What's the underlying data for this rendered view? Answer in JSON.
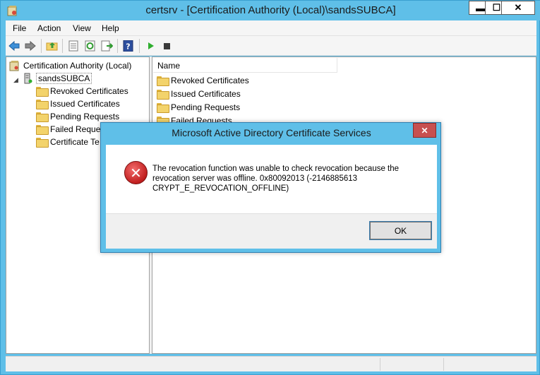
{
  "window": {
    "title": "certsrv - [Certification Authority (Local)\\sandsSUBCA]",
    "minimize_glyph": "▬",
    "maximize_glyph": "☐",
    "close_glyph": "✕"
  },
  "menu": [
    "File",
    "Action",
    "View",
    "Help"
  ],
  "toolbar_icons": [
    "back-arrow-icon",
    "forward-arrow-icon",
    "up-folder-icon",
    "properties-icon",
    "refresh-icon",
    "export-list-icon",
    "help-icon",
    "start-service-icon",
    "stop-service-icon"
  ],
  "tree": {
    "root": "Certification Authority (Local)",
    "server": "sandsSUBCA",
    "children": [
      "Revoked Certificates",
      "Issued Certificates",
      "Pending Requests",
      "Failed Reques",
      "Certificate Te"
    ]
  },
  "list": {
    "column_header": "Name",
    "items": [
      "Revoked Certificates",
      "Issued Certificates",
      "Pending Requests",
      "Failed Requests"
    ]
  },
  "dialog": {
    "title": "Microsoft Active Directory Certificate Services",
    "close_glyph": "✕",
    "error_glyph": "✕",
    "message_lines": [
      "The revocation function was unable to check revocation because the",
      "revocation server was offline. 0x80092013 (-2146885613",
      "CRYPT_E_REVOCATION_OFFLINE)"
    ],
    "ok_label": "OK"
  },
  "colors": {
    "chrome": "#5fbfe8",
    "close_red": "#c75050",
    "error_red": "#c11f1f"
  }
}
